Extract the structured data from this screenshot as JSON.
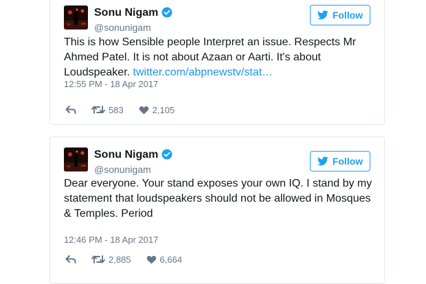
{
  "tweets": [
    {
      "author": {
        "name": "Sonu Nigam",
        "handle": "@sonunigam"
      },
      "follow_label": "Follow",
      "text": "This is how Sensible people Interpret an issue. Respects Mr Ahmed Patel. It is not about Azaan or Aarti. It's about Loudspeaker. ",
      "link": "twitter.com/abpnewstv/stat…",
      "timestamp": "12:55 PM - 18 Apr 2017",
      "retweets": "583",
      "likes": "2,105"
    },
    {
      "author": {
        "name": "Sonu Nigam",
        "handle": "@sonunigam"
      },
      "follow_label": "Follow",
      "text": "Dear everyone. Your stand exposes your own IQ. I stand by my statement that loudspeakers should not be allowed in Mosques & Temples. Period",
      "link": "",
      "timestamp": "12:46 PM - 18 Apr 2017",
      "retweets": "2,885",
      "likes": "6,664"
    }
  ],
  "icons": {
    "verified": "verified-badge-icon",
    "follow": "twitter-bird-icon",
    "reply": "reply-arrow-icon",
    "retweet": "retweet-icon",
    "like": "heart-icon"
  },
  "colors": {
    "accent": "#1da1f2",
    "link": "#1b95e0",
    "muted": "#657786",
    "border": "#e1e8ed",
    "text": "#14171a"
  }
}
